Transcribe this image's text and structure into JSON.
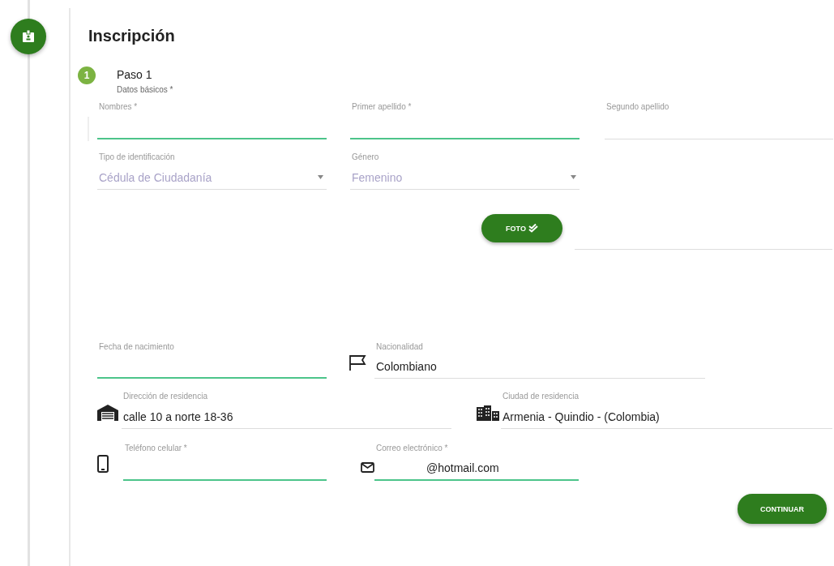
{
  "title": "Inscripción",
  "step": {
    "number": "1",
    "title": "Paso 1",
    "subtitle": "Datos básicos *"
  },
  "fields": [
    {
      "label": "Nombres *",
      "kind": "text",
      "highlighted": true
    },
    {
      "label": "Primer apellido *",
      "kind": "text",
      "highlighted": true
    },
    {
      "label": "Segundo apellido",
      "kind": "text",
      "highlighted": false
    },
    {
      "label": "Tipo de identificación",
      "value": "Cédula de Ciudadanía",
      "kind": "select",
      "highlighted": false
    },
    {
      "label": "Género",
      "value": "Femenino",
      "kind": "select",
      "highlighted": false
    },
    {
      "kind": "text",
      "highlighted": false
    },
    {
      "label": "Fecha de nacimiento",
      "kind": "text",
      "highlighted": true
    },
    {
      "label": "Nacionalidad",
      "value": "Colombiano",
      "kind": "text",
      "highlighted": false
    },
    {
      "label": "Dirección de residencia",
      "value": "calle 10 a norte 18-36",
      "kind": "text",
      "highlighted": false
    },
    {
      "label": "Ciudad de residencia",
      "value": "Armenia - Quindio - (Colombia)",
      "kind": "text",
      "highlighted": false
    },
    {
      "label": "Teléfono celular *",
      "kind": "text",
      "highlighted": true
    },
    {
      "label": "Correo electrónico *",
      "value": "@hotmail.com",
      "kind": "text",
      "highlighted": true
    }
  ],
  "photo_button": "FOTO",
  "continue_button": "CONTINUAR"
}
